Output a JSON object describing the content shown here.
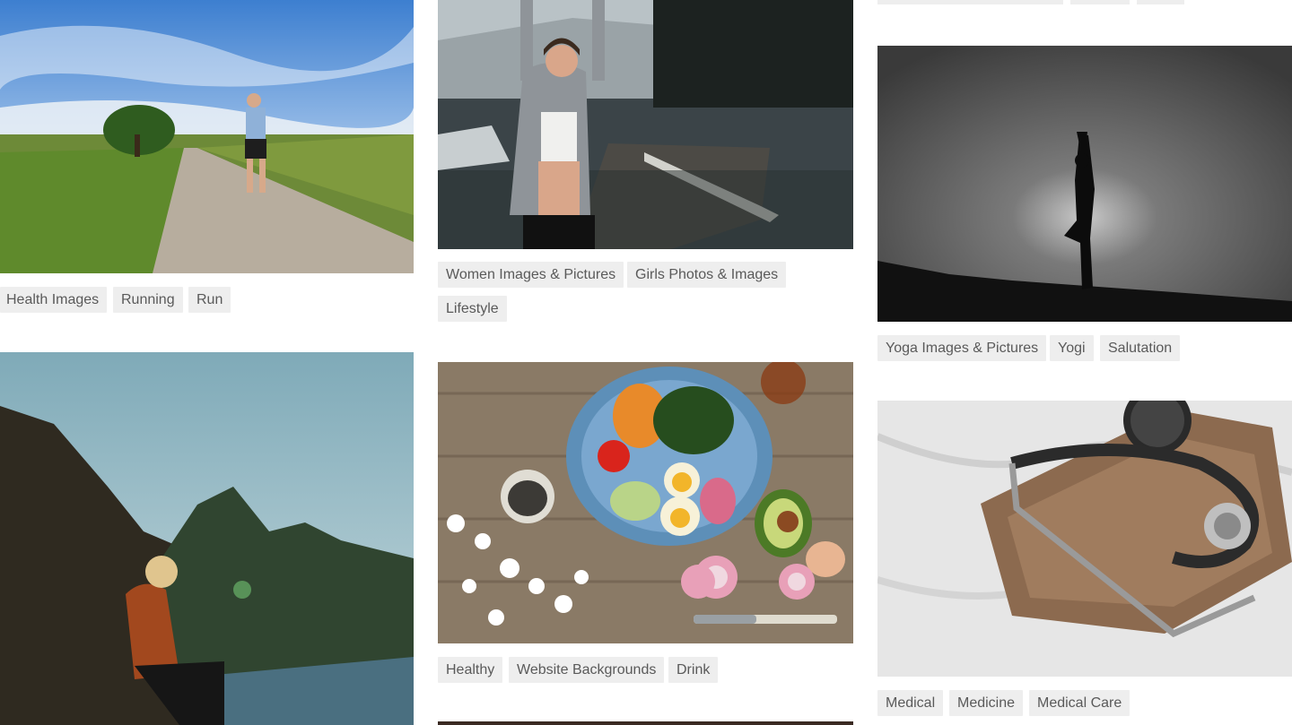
{
  "gallery": {
    "photos": [
      {
        "name": "runner-on-path",
        "tags": [
          "Health Images",
          "Running",
          "Run"
        ]
      },
      {
        "name": "woman-stretching-on-dock",
        "tags": [
          "Women Images & Pictures",
          "Girls Photos & Images",
          "Lifestyle"
        ]
      },
      {
        "name": "yoga-silhouette",
        "tags": [
          "Yoga Images & Pictures",
          "Yogi",
          "Salutation"
        ]
      },
      {
        "name": "woman-by-river",
        "tags": []
      },
      {
        "name": "healthy-salad-plate",
        "tags": [
          "Healthy",
          "Website Backgrounds",
          "Drink"
        ]
      },
      {
        "name": "stethoscope-on-bed",
        "tags": [
          "Medical",
          "Medicine",
          "Medical Care"
        ]
      }
    ]
  }
}
